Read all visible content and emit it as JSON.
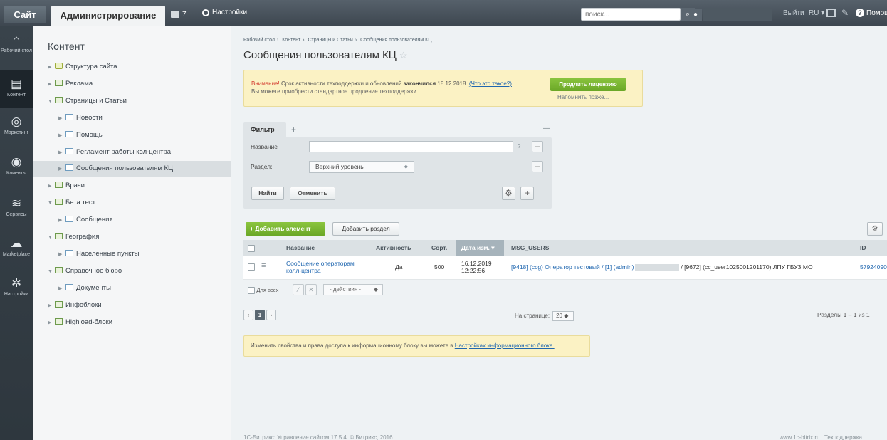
{
  "topbar": {
    "tab_site": "Сайт",
    "tab_admin": "Администрирование",
    "notifications_count": "7",
    "settings": "Настройки",
    "search_placeholder": "поиск...",
    "exit": "Выйти",
    "lang": "RU",
    "help": "Помощь"
  },
  "leftnav": [
    {
      "label": "Рабочий стол",
      "icon": "home-icon"
    },
    {
      "label": "Контент",
      "icon": "document-icon"
    },
    {
      "label": "Маркетинг",
      "icon": "target-icon"
    },
    {
      "label": "Клиенты",
      "icon": "clients-icon"
    },
    {
      "label": "Сервисы",
      "icon": "layers-icon"
    },
    {
      "label": "Marketplace",
      "icon": "cloud-icon"
    },
    {
      "label": "Настройки",
      "icon": "gear-icon"
    }
  ],
  "tree": {
    "title": "Контент",
    "items": [
      {
        "label": "Структура сайта",
        "level": 0,
        "expanded": false
      },
      {
        "label": "Реклама",
        "level": 0,
        "expanded": false
      },
      {
        "label": "Страницы и Статьи",
        "level": 0,
        "expanded": true
      },
      {
        "label": "Новости",
        "level": 1,
        "expanded": false
      },
      {
        "label": "Помощь",
        "level": 1,
        "expanded": false
      },
      {
        "label": "Регламент работы кол-центра",
        "level": 1,
        "expanded": false
      },
      {
        "label": "Сообщения пользователям КЦ",
        "level": 1,
        "expanded": false,
        "selected": true
      },
      {
        "label": "Врачи",
        "level": 0,
        "expanded": false
      },
      {
        "label": "Бета тест",
        "level": 0,
        "expanded": true
      },
      {
        "label": "Сообщения",
        "level": 1,
        "expanded": false
      },
      {
        "label": "География",
        "level": 0,
        "expanded": true
      },
      {
        "label": "Населенные пункты",
        "level": 1,
        "expanded": false
      },
      {
        "label": "Справочное бюро",
        "level": 0,
        "expanded": true
      },
      {
        "label": "Документы",
        "level": 1,
        "expanded": false
      },
      {
        "label": "Инфоблоки",
        "level": 0,
        "expanded": false
      },
      {
        "label": "Highload-блоки",
        "level": 0,
        "expanded": false
      }
    ]
  },
  "breadcrumbs": [
    "Рабочий стол",
    "Контент",
    "Страницы и Статьи",
    "Сообщения пользователям КЦ"
  ],
  "page_title": "Сообщения пользователям КЦ",
  "alert": {
    "warning": "Внимание!",
    "text1": " Срок активности техподдержки и обновлений ",
    "bold": "закончился",
    "text2": " 18.12.2018. ",
    "link": "(Что это такое?)",
    "line2": "Вы можете приобрести стандартное продление техподдержки.",
    "button": "Продлить лицензию",
    "remind": "Напомнить позже..."
  },
  "filter": {
    "tab": "Фильтр",
    "name_label": "Название",
    "section_label": "Раздел:",
    "section_value": "Верхний уровень",
    "find": "Найти",
    "cancel": "Отменить",
    "help_mark": "?"
  },
  "toolbar": {
    "add_element": "Добавить элемент",
    "add_section": "Добавить раздел"
  },
  "grid": {
    "columns": {
      "name": "Название",
      "active": "Активность",
      "sort": "Сорт.",
      "date": "Дата изм.",
      "msg_users": "MSG_USERS",
      "id": "ID"
    },
    "rows": [
      {
        "name_line1": "Сообщение операторам",
        "name_line2": "колл-центра",
        "active": "Да",
        "sort": "500",
        "date_line1": "16.12.2019",
        "date_line2": "12:22:56",
        "msg_part1": "[9418] (ccg) Оператор тестовый / [1] (admin)",
        "msg_part2": "/ [9672] (cc_user1025001201170) ЛПУ ГБУЗ МО",
        "id": "57924090"
      }
    ],
    "for_all": "Для всех",
    "actions": "- действия -"
  },
  "pager": {
    "current": "1",
    "per_page_label": "На странице:",
    "per_page_value": "20",
    "sections": "Разделы 1 – 1 из 1"
  },
  "info": {
    "text": "Изменить свойства и права доступа к информационному блоку вы можете в ",
    "link": "Настройках информационного блока."
  },
  "footer": {
    "left": "1С-Битрикс: Управление сайтом 17.5.4. © Битрикс, 2016",
    "right": "www.1c-bitrix.ru  |  Техподдержка"
  }
}
